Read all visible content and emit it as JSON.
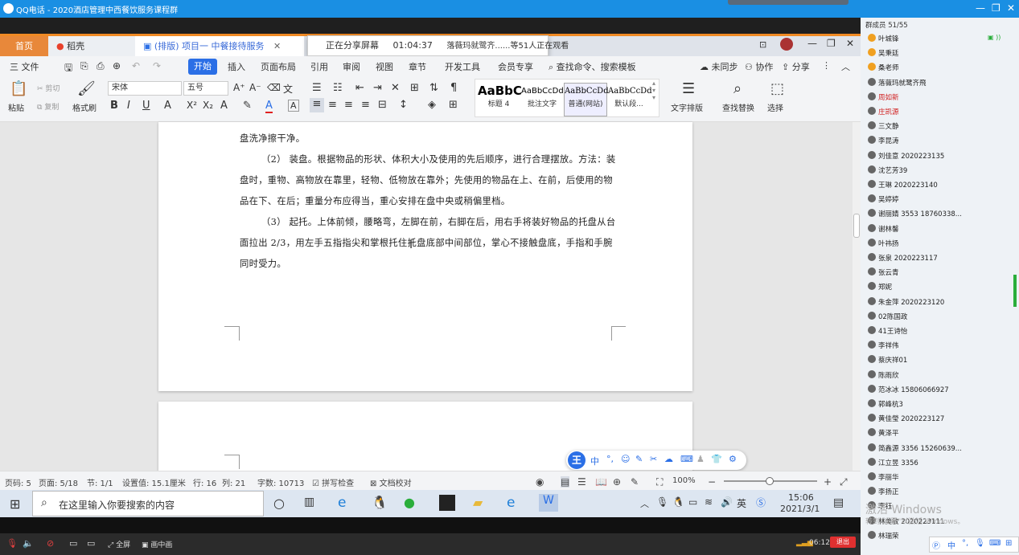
{
  "qq_window": {
    "title": "QQ电话 - 2020酒店管理中西餐饮服务课程群"
  },
  "wps": {
    "tabs": {
      "home": "首页",
      "docer": "稻壳",
      "doc": "(排版) 项目一 中餐接待服务"
    },
    "share_banner": {
      "status": "正在分享屏幕",
      "time": "01:04:37",
      "viewers": "落薇玛就鹭齐......等51人正在观看"
    },
    "menu": {
      "file": "三 文件",
      "start": "开始",
      "insert": "插入",
      "layout": "页面布局",
      "reference": "引用",
      "review": "审阅",
      "view": "视图",
      "chapter": "章节",
      "dev": "开发工具",
      "member": "会员专享",
      "search": "查找命令、搜索模板",
      "unsync": "未同步",
      "collab": "协作",
      "share": "分享"
    },
    "ribbon": {
      "paste": "粘贴",
      "cut": "剪切",
      "copy": "复制",
      "format_painter": "格式刷",
      "font_name": "宋体",
      "font_size": "五号",
      "styles": [
        {
          "preview": "AaBbC",
          "name": "标题 4"
        },
        {
          "preview": "AaBbCcDd",
          "name": "批注文字"
        },
        {
          "preview": "AaBbCcDd",
          "name": "普通(网站)"
        },
        {
          "preview": "AaBbCcDd",
          "name": "默认段..."
        }
      ],
      "text_layout": "文字排版",
      "find_replace": "查找替换",
      "select": "选择"
    },
    "document": {
      "lines": [
        "盘洗净擦干净。",
        "（2）  装盘。根据物品的形状、体积大小及使用的先后顺序，进行合理摆放。方法：装",
        "盘时，重物、高物放在靠里，轻物、低物放在靠外；先使用的物品在上、在前，后使用的物",
        "品在下、在后；重量分布应得当，重心安排在盘中央或稍偏里档。",
        "（3）  起托。上体前倾，腰略弯，左脚在前，右脚在后，用右手将装好物品的托盘从台",
        "面拉出 2/3，用左手五指指尖和掌根托住托盘底部中间部位，掌心不接触盘底，手指和手腕",
        "同时受力。"
      ]
    },
    "ime_label": "中",
    "status": {
      "page_code": "页码: 5",
      "page": "页面: 5/18",
      "section": "节: 1/1",
      "setting": "设置值: 15.1厘米",
      "row": "行: 16",
      "col": "列: 21",
      "words": "字数: 10713",
      "spell": "拼写检查",
      "proof": "文档校对",
      "zoom": "100%"
    }
  },
  "taskbar": {
    "search_placeholder": "在这里输入你要搜索的内容",
    "time": "15:06",
    "date": "2021/3/1",
    "ime": "英"
  },
  "call_bar": {
    "fullscreen": "全屏",
    "pip": "画中画",
    "duration": "06:12",
    "exit": "退出"
  },
  "members": {
    "header": "群成员 51/55",
    "list": [
      "叶城锋",
      "吴秉廷",
      "桑老师",
      "落薇玛就鹭齐飛",
      "周如新",
      "庄凯源",
      "三文静",
      "李昆涛",
      "刘佳意 2020223135",
      "沈艺芳39",
      "王琳 2020223140",
      "吴婷婷",
      "谢丽婧 3553 18760338...",
      "谢林馨",
      "叶祎扬",
      "张泉 2020223117",
      "张云青",
      "郑妮",
      "朱金萍 2020223120",
      "02陈国政",
      "41王诗怡",
      "李祥伟",
      "蔡庆祥01",
      "陈雨欣",
      "范冰冰 15806066927",
      "郭峰杭3",
      "黄佳瑩 2020223127",
      "黄泽平",
      "简鑫源 3356 15260639...",
      "江立昱 3356",
      "李丽华",
      "李扬正",
      "李钰",
      "林美敏 2020223111",
      "林瑞荣"
    ],
    "highlight_colors": {
      "周如新": "#d02020",
      "庄凯源": "#d02020"
    }
  },
  "watermark": {
    "line1": "激活 Windows",
    "line2": "转到\"设置\"以激活 Windows。"
  }
}
